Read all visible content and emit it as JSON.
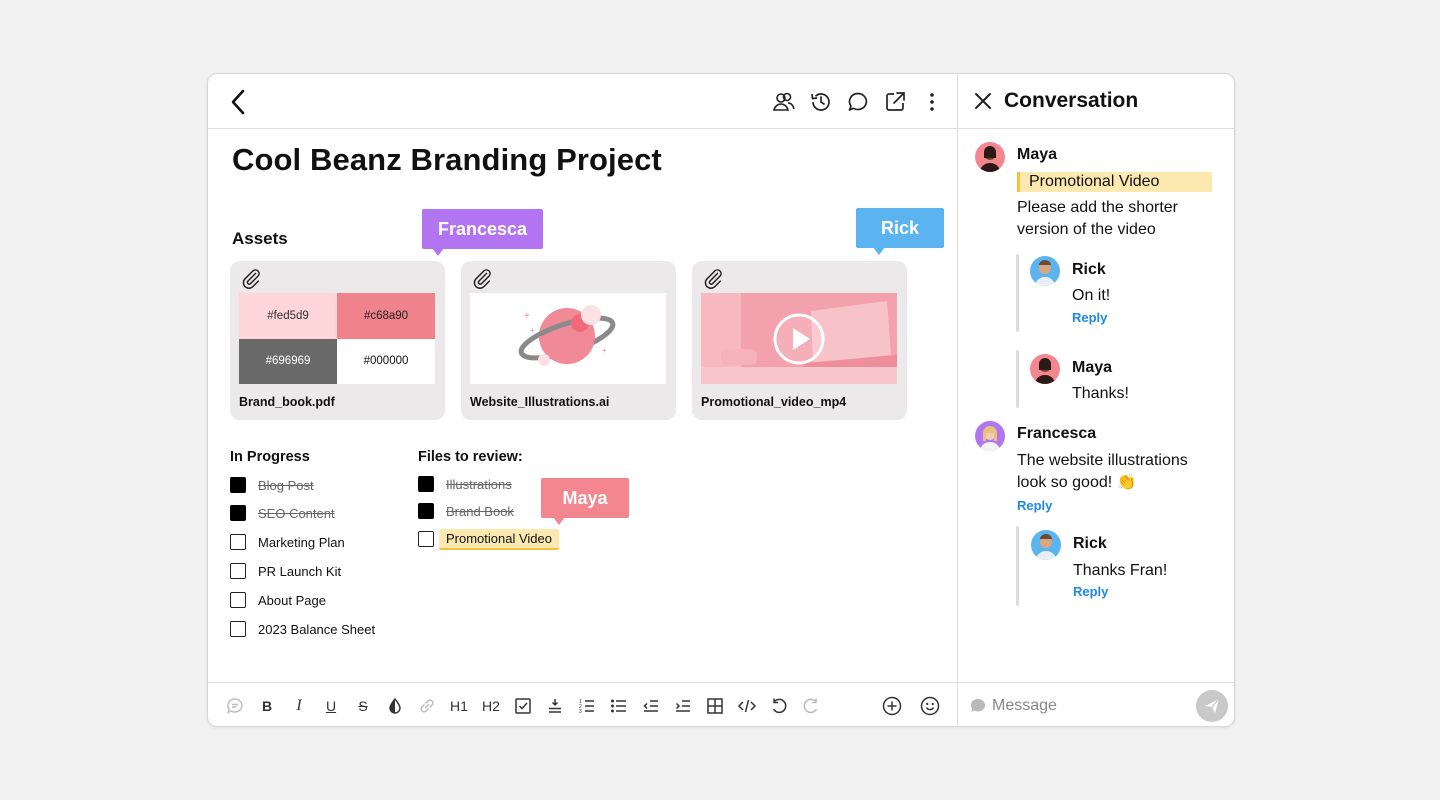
{
  "document": {
    "title": "Cool Beanz Branding Project"
  },
  "assets": {
    "heading": "Assets",
    "files": [
      {
        "name": "Brand_book.pdf",
        "swatches": [
          "#fed5d9",
          "#c68a90",
          "#696969",
          "#000000"
        ]
      },
      {
        "name": "Website_Illustrations.ai"
      },
      {
        "name": "Promotional_video_mp4"
      }
    ]
  },
  "cursors": {
    "francesca": "Francesca",
    "rick": "Rick",
    "maya": "Maya"
  },
  "in_progress": {
    "heading": "In Progress",
    "items": [
      {
        "label": "Blog Post",
        "done": true
      },
      {
        "label": "SEO Content",
        "done": true
      },
      {
        "label": "Marketing Plan",
        "done": false
      },
      {
        "label": "PR Launch Kit",
        "done": false
      },
      {
        "label": "About Page",
        "done": false
      },
      {
        "label": "2023 Balance Sheet",
        "done": false
      }
    ]
  },
  "review": {
    "heading": "Files to review:",
    "items": [
      {
        "label": "Illustrations",
        "done": true
      },
      {
        "label": "Brand Book",
        "done": true
      },
      {
        "label": "Promotional Video",
        "done": false
      }
    ]
  },
  "toolbar": {
    "h1": "H1",
    "h2": "H2"
  },
  "conversation": {
    "title": "Conversation",
    "messages": [
      {
        "author": "Maya",
        "quote": "Promotional Video",
        "text": "Please add the shorter version of the video",
        "replies": [
          {
            "author": "Rick",
            "text": "On it!",
            "reply": "Reply"
          },
          {
            "author": "Maya",
            "text": "Thanks!"
          }
        ]
      },
      {
        "author": "Francesca",
        "text": "The website illustrations look so good! 👏",
        "reply": "Reply",
        "replies": [
          {
            "author": "Rick",
            "text": "Thanks Fran!",
            "reply": "Reply"
          }
        ]
      }
    ],
    "input_placeholder": "Message"
  },
  "colors": {
    "francesca": "#b274f0",
    "rick": "#5bb4ef",
    "maya": "#f4868f",
    "highlight": "#fbe9b0",
    "link": "#1e88e5"
  }
}
